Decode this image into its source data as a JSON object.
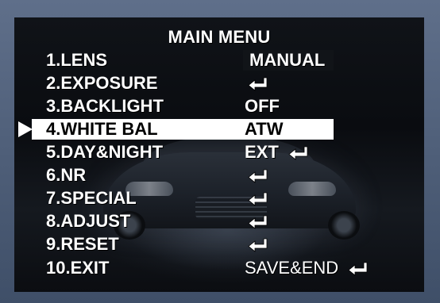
{
  "menu": {
    "title": "MAIN MENU",
    "items": [
      {
        "label": "1.LENS",
        "value": "MANUAL",
        "enter": false
      },
      {
        "label": "2.EXPOSURE",
        "value": "",
        "enter": true
      },
      {
        "label": "3.BACKLIGHT",
        "value": "OFF",
        "enter": false
      },
      {
        "label": "4.WHITE BAL",
        "value": "ATW",
        "enter": false
      },
      {
        "label": "5.DAY&NIGHT",
        "value": "EXT",
        "enter": true
      },
      {
        "label": "6.NR",
        "value": "",
        "enter": true
      },
      {
        "label": "7.SPECIAL",
        "value": "",
        "enter": true
      },
      {
        "label": "8.ADJUST",
        "value": "",
        "enter": true
      },
      {
        "label": "9.RESET",
        "value": "",
        "enter": true
      },
      {
        "label": "10.EXIT",
        "value": "SAVE&END",
        "enter": true
      }
    ],
    "selected_index": 3
  },
  "icons": {
    "pointer": "pointer-arrow-icon",
    "enter": "enter-return-icon"
  },
  "colors": {
    "text": "#ffffff",
    "selection_bg": "#ffffff",
    "selection_text": "#000000",
    "frame": "#4a5a74"
  }
}
